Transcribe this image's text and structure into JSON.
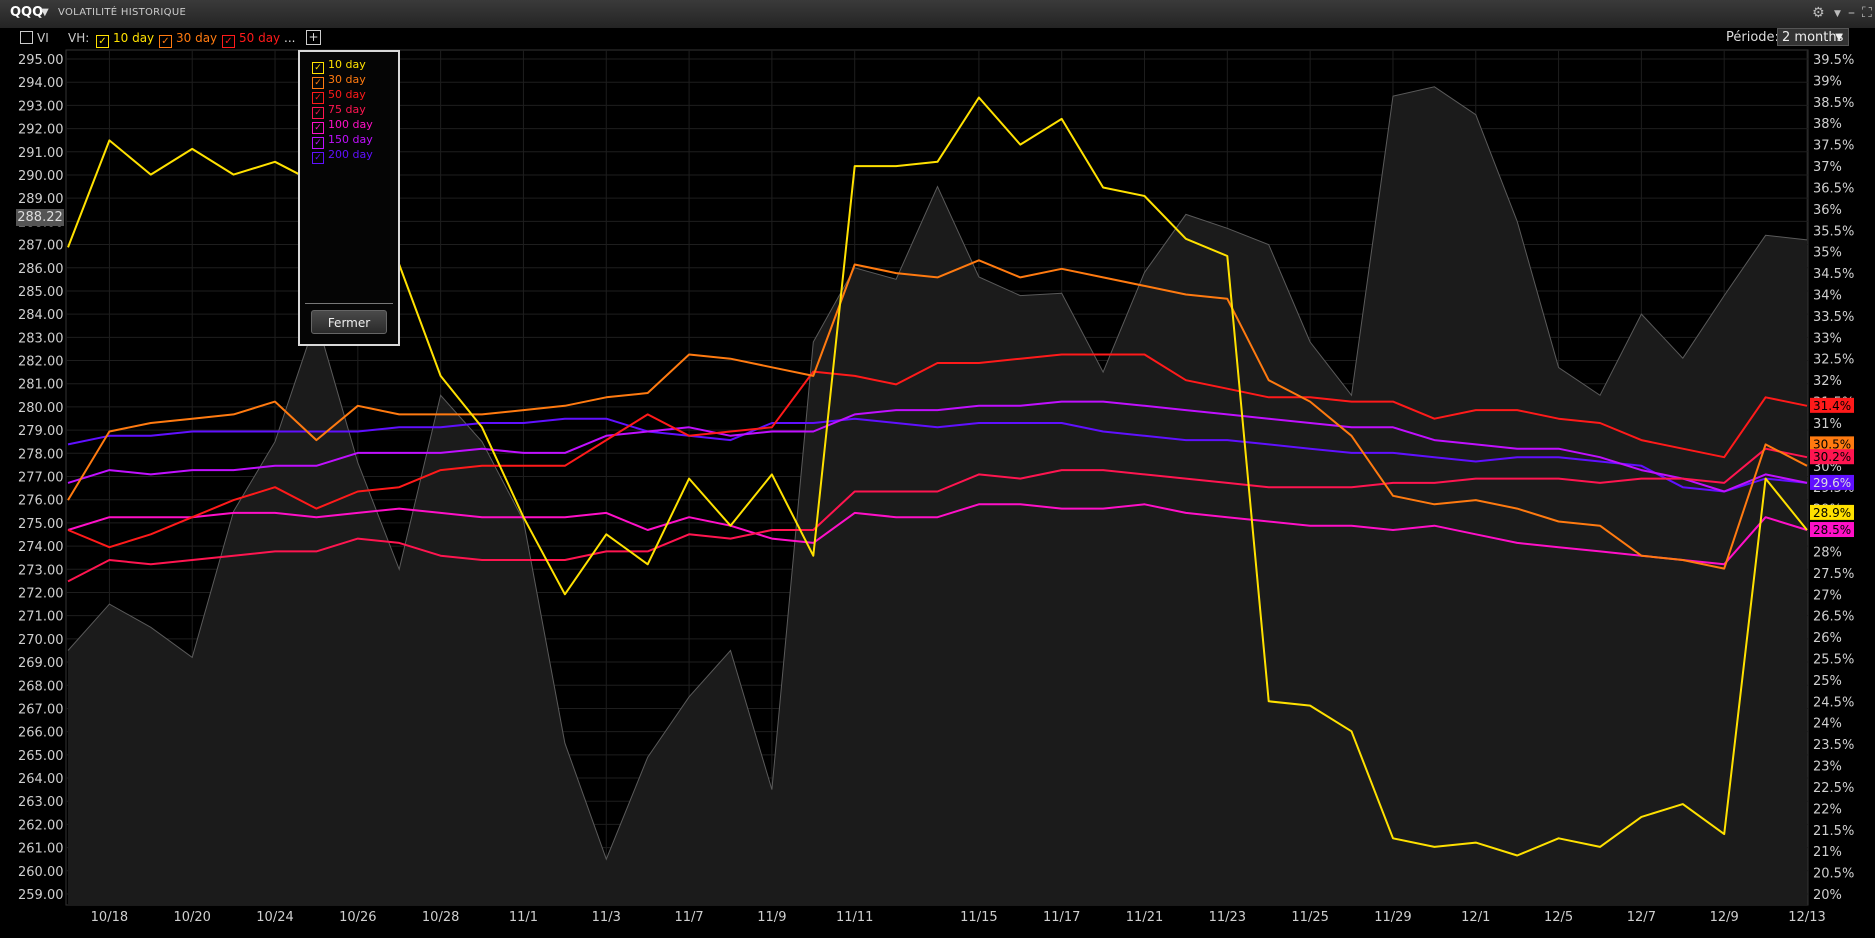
{
  "window": {
    "ticker": "QQQ",
    "title": "VOLATILITÉ HISTORIQUE",
    "settings_icon": "gear-icon"
  },
  "toolbar": {
    "vi_label": "VI",
    "vh_label": "VH:",
    "series": [
      {
        "label": "10 day",
        "color": "#ffe100"
      },
      {
        "label": "30 day",
        "color": "#ff7a10"
      },
      {
        "label": "50 day",
        "color": "#ff1a1a"
      }
    ],
    "more": "...",
    "period_label": "Période:",
    "period_value": "2 months"
  },
  "popup": {
    "items": [
      {
        "label": "10 day",
        "color": "#ffe100"
      },
      {
        "label": "30 day",
        "color": "#ff7a10"
      },
      {
        "label": "50 day",
        "color": "#ff1a1a"
      },
      {
        "label": "75 day",
        "color": "#ff1550"
      },
      {
        "label": "100 day",
        "color": "#ff10c8"
      },
      {
        "label": "150 day",
        "color": "#c010ff"
      },
      {
        "label": "200 day",
        "color": "#6010ff"
      }
    ],
    "close_label": "Fermer"
  },
  "price_marker": "288.22",
  "chart_data": {
    "type": "line",
    "n_points": 43,
    "x_tick_labels": [
      "10/18",
      "10/20",
      "10/24",
      "10/26",
      "10/28",
      "11/1",
      "11/3",
      "11/7",
      "11/9",
      "11/11",
      "11/15",
      "11/17",
      "11/21",
      "11/23",
      "11/25",
      "11/29",
      "12/1",
      "12/5",
      "12/7",
      "12/9",
      "12/13"
    ],
    "left_axis": {
      "min": 259,
      "max": 295,
      "step": 1,
      "decimals": 2
    },
    "right_axis": {
      "min": 20.0,
      "max": 39.5,
      "step": 0.5,
      "unit": "%"
    },
    "price": [
      269.5,
      271.5,
      270.5,
      269.2,
      275.5,
      278.5,
      283.8,
      277.6,
      273.0,
      280.5,
      278.5,
      275.1,
      265.5,
      260.5,
      264.9,
      267.5,
      269.5,
      263.5,
      282.8,
      286.0,
      285.5,
      289.5,
      285.6,
      284.8,
      284.9,
      281.5,
      285.8,
      288.3,
      287.7,
      287.0,
      282.8,
      280.5,
      293.4,
      293.8,
      292.6,
      288.0,
      281.7,
      280.5,
      284.0,
      282.1,
      284.8,
      287.4,
      287.2
    ],
    "series": [
      {
        "name": "10 day",
        "color": "#ffe100",
        "values": [
          35.1,
          37.6,
          36.8,
          37.4,
          36.8,
          37.1,
          36.6,
          35.8,
          34.7,
          32.1,
          30.9,
          28.8,
          27.0,
          28.4,
          27.7,
          29.7,
          28.6,
          29.8,
          27.9,
          37.0,
          37.0,
          37.1,
          38.6,
          37.5,
          38.1,
          36.5,
          36.3,
          35.3,
          34.9,
          24.5,
          24.4,
          23.8,
          21.3,
          21.1,
          21.2,
          20.9,
          21.3,
          21.1,
          21.8,
          22.1,
          21.4,
          29.7,
          28.5
        ]
      },
      {
        "name": "30 day",
        "color": "#ff7a10",
        "values": [
          29.2,
          30.8,
          31.0,
          31.1,
          31.2,
          31.5,
          30.6,
          31.4,
          31.2,
          31.2,
          31.2,
          31.3,
          31.4,
          31.6,
          31.7,
          32.6,
          32.5,
          32.3,
          32.1,
          34.7,
          34.5,
          34.4,
          34.8,
          34.4,
          34.6,
          34.4,
          34.2,
          34.0,
          33.9,
          32.0,
          31.5,
          30.7,
          29.3,
          29.1,
          29.2,
          29.0,
          28.7,
          28.6,
          27.9,
          27.8,
          27.6,
          30.5,
          30.0
        ]
      },
      {
        "name": "50 day",
        "color": "#ff1a1a",
        "values": [
          28.5,
          28.1,
          28.4,
          28.8,
          29.2,
          29.5,
          29.0,
          29.4,
          29.5,
          29.9,
          30.0,
          30.0,
          30.0,
          30.6,
          31.2,
          30.7,
          30.8,
          30.9,
          32.2,
          32.1,
          31.9,
          32.4,
          32.4,
          32.5,
          32.6,
          32.6,
          32.6,
          32.0,
          31.8,
          31.6,
          31.6,
          31.5,
          31.5,
          31.1,
          31.3,
          31.3,
          31.1,
          31.0,
          30.6,
          30.4,
          30.2,
          31.6,
          31.4
        ]
      },
      {
        "name": "75 day",
        "color": "#ff1550",
        "values": [
          27.3,
          27.8,
          27.7,
          27.8,
          27.9,
          28.0,
          28.0,
          28.3,
          28.2,
          27.9,
          27.8,
          27.8,
          27.8,
          28.0,
          28.0,
          28.4,
          28.3,
          28.5,
          28.5,
          29.4,
          29.4,
          29.4,
          29.8,
          29.7,
          29.9,
          29.9,
          29.8,
          29.7,
          29.6,
          29.5,
          29.5,
          29.5,
          29.6,
          29.6,
          29.7,
          29.7,
          29.7,
          29.6,
          29.7,
          29.7,
          29.6,
          30.4,
          30.2
        ]
      },
      {
        "name": "100 day",
        "color": "#ff10c8",
        "values": [
          28.5,
          28.8,
          28.8,
          28.8,
          28.9,
          28.9,
          28.8,
          28.9,
          29.0,
          28.9,
          28.8,
          28.8,
          28.8,
          28.9,
          28.5,
          28.8,
          28.6,
          28.3,
          28.2,
          28.9,
          28.8,
          28.8,
          29.1,
          29.1,
          29.0,
          29.0,
          29.1,
          28.9,
          28.8,
          28.7,
          28.6,
          28.6,
          28.5,
          28.6,
          28.4,
          28.2,
          28.1,
          28.0,
          27.9,
          27.8,
          27.7,
          28.8,
          28.5
        ]
      },
      {
        "name": "150 day",
        "color": "#c010ff",
        "values": [
          29.6,
          29.9,
          29.8,
          29.9,
          29.9,
          30.0,
          30.0,
          30.3,
          30.3,
          30.3,
          30.4,
          30.3,
          30.3,
          30.7,
          30.8,
          30.9,
          30.7,
          30.8,
          30.8,
          31.2,
          31.3,
          31.3,
          31.4,
          31.4,
          31.5,
          31.5,
          31.4,
          31.3,
          31.2,
          31.1,
          31.0,
          30.9,
          30.9,
          30.6,
          30.5,
          30.4,
          30.4,
          30.2,
          29.9,
          29.7,
          29.4,
          29.8,
          29.6
        ]
      },
      {
        "name": "200 day",
        "color": "#6010ff",
        "values": [
          30.5,
          30.7,
          30.7,
          30.8,
          30.8,
          30.8,
          30.8,
          30.8,
          30.9,
          30.9,
          31.0,
          31.0,
          31.1,
          31.1,
          30.8,
          30.7,
          30.6,
          31.0,
          31.0,
          31.1,
          31.0,
          30.9,
          31.0,
          31.0,
          31.0,
          30.8,
          30.7,
          30.6,
          30.6,
          30.5,
          30.4,
          30.3,
          30.3,
          30.2,
          30.1,
          30.2,
          30.2,
          30.1,
          30.0,
          29.5,
          29.4,
          29.7,
          29.6
        ]
      }
    ],
    "right_badges": [
      {
        "text": "31.4%",
        "value": 31.4,
        "bg": "#ff1a1a",
        "fg": "#000"
      },
      {
        "text": "30.5%",
        "value": 30.5,
        "bg": "#ff7a10",
        "fg": "#000"
      },
      {
        "text": "30.2%",
        "value": 30.2,
        "bg": "#ff1550",
        "fg": "#000"
      },
      {
        "text": "29.6%",
        "value": 29.6,
        "bg": "#6010ff",
        "fg": "#ddd"
      },
      {
        "text": "28.9%",
        "value": 28.9,
        "bg": "#ffe100",
        "fg": "#000"
      },
      {
        "text": "28.5%",
        "value": 28.5,
        "bg": "#ff10c8",
        "fg": "#000"
      }
    ],
    "grid": true
  }
}
